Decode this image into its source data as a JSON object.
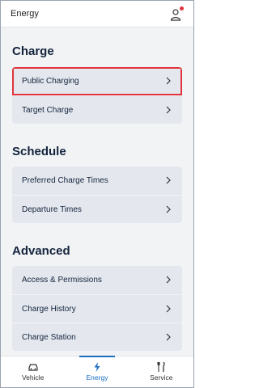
{
  "header": {
    "title": "Energy"
  },
  "colors": {
    "accent": "#1b6ec2",
    "highlight": "#e0343c",
    "notification": "#e0343c"
  },
  "sections": [
    {
      "title": "Charge",
      "items": [
        {
          "label": "Public Charging"
        },
        {
          "label": "Target Charge"
        }
      ]
    },
    {
      "title": "Schedule",
      "items": [
        {
          "label": "Preferred Charge Times"
        },
        {
          "label": "Departure Times"
        }
      ]
    },
    {
      "title": "Advanced",
      "items": [
        {
          "label": "Access & Permissions"
        },
        {
          "label": "Charge History"
        },
        {
          "label": "Charge Station"
        }
      ]
    }
  ],
  "nav": [
    {
      "label": "Vehicle",
      "icon": "car-icon"
    },
    {
      "label": "Energy",
      "icon": "lightning-icon",
      "active": true
    },
    {
      "label": "Service",
      "icon": "tools-icon"
    }
  ]
}
